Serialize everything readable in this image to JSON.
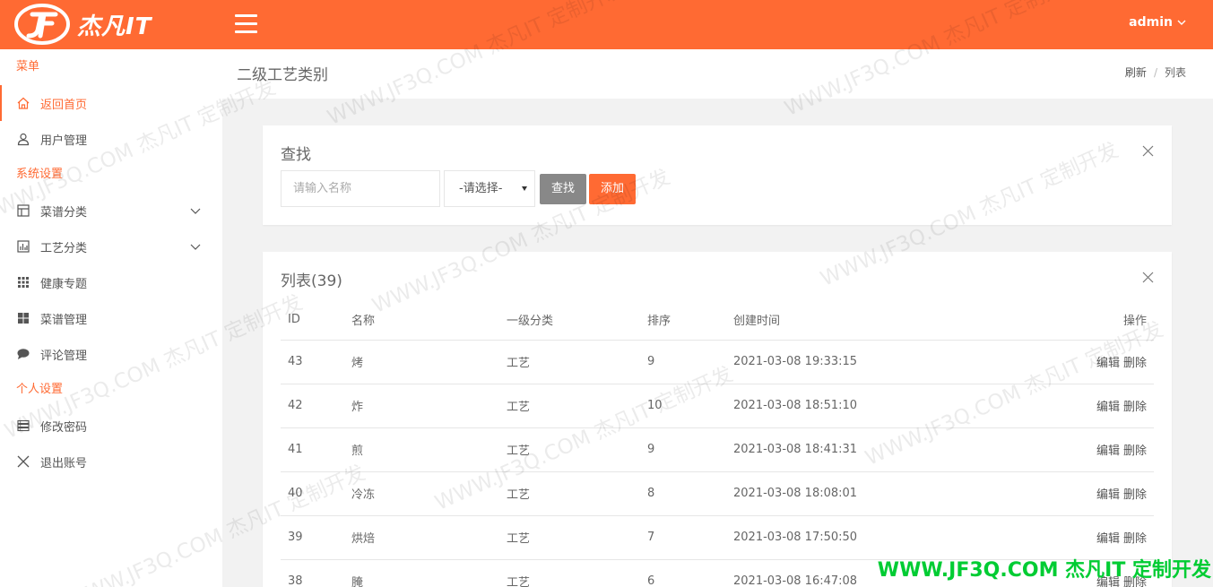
{
  "header": {
    "logo_text": "杰凡IT",
    "user": "admin"
  },
  "sidebar": {
    "sections": [
      {
        "title": "菜单",
        "items": [
          {
            "label": "返回首页",
            "icon": "home-icon",
            "active": true
          },
          {
            "label": "用户管理",
            "icon": "user-icon"
          }
        ]
      },
      {
        "title": "系统设置",
        "items": [
          {
            "label": "菜谱分类",
            "icon": "layout-icon",
            "arrow": true
          },
          {
            "label": "工艺分类",
            "icon": "chart-icon",
            "arrow": true
          },
          {
            "label": "健康专题",
            "icon": "grid-icon"
          },
          {
            "label": "菜谱管理",
            "icon": "apps-icon"
          },
          {
            "label": "评论管理",
            "icon": "comment-icon"
          }
        ]
      },
      {
        "title": "个人设置",
        "items": [
          {
            "label": "修改密码",
            "icon": "list-icon"
          },
          {
            "label": "退出账号",
            "icon": "close-icon"
          }
        ]
      }
    ]
  },
  "page": {
    "title": "二级工艺类别",
    "breadcrumb": [
      "刷新",
      "列表"
    ]
  },
  "search": {
    "title": "查找",
    "input_placeholder": "请输入名称",
    "select_value": "-请选择-",
    "search_label": "查找",
    "add_label": "添加"
  },
  "list": {
    "title": "列表(39)",
    "columns": [
      "ID",
      "名称",
      "一级分类",
      "排序",
      "创建时间",
      "操作"
    ],
    "edit_label": "编辑",
    "delete_label": "删除",
    "rows": [
      {
        "id": "43",
        "name": "烤",
        "category": "工艺",
        "sort": "9",
        "created": "2021-03-08 19:33:15"
      },
      {
        "id": "42",
        "name": "炸",
        "category": "工艺",
        "sort": "10",
        "created": "2021-03-08 18:51:10"
      },
      {
        "id": "41",
        "name": "煎",
        "category": "工艺",
        "sort": "9",
        "created": "2021-03-08 18:41:31"
      },
      {
        "id": "40",
        "name": "冷冻",
        "category": "工艺",
        "sort": "8",
        "created": "2021-03-08 18:08:01"
      },
      {
        "id": "39",
        "name": "烘焙",
        "category": "工艺",
        "sort": "7",
        "created": "2021-03-08 17:50:50"
      },
      {
        "id": "38",
        "name": "腌",
        "category": "工艺",
        "sort": "6",
        "created": "2021-03-08 16:47:08"
      }
    ]
  },
  "watermark": {
    "repeat_text": "WWW.JF3Q.COM 杰凡IT 定制开发",
    "footer_text": "WWW.JF3Q.COM 杰凡IT  定制开发"
  },
  "colors": {
    "accent": "#ff6a33",
    "button_gray": "#888888",
    "footer_watermark": "#00cc33"
  }
}
